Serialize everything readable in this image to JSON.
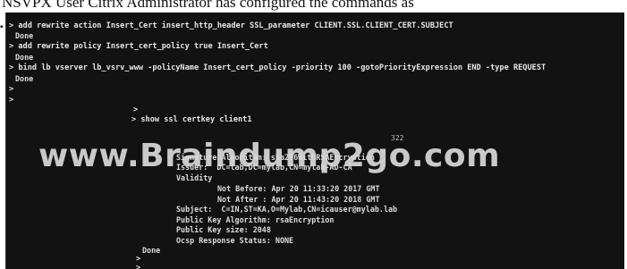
{
  "header_strip": {
    "text": "NSVPX User Citrix Administrator has configured the commands as"
  },
  "terminal": {
    "block1": [
      "> add rewrite action Insert_Cert insert_http_header SSL_parameter CLIENT.SSL.CLIENT_CERT.SUBJECT",
      "Done",
      "> add rewrite policy Insert_cert_policy true Insert_Cert",
      "Done",
      "> bind lb vserver lb_vsrv_www -policyName Insert_cert_policy -priority 100 -gotoPriorityExpression END -type REQUEST",
      "Done",
      ">",
      ">"
    ],
    "block2_prompt": ">",
    "block2_cmd": "> show ssl certkey client1",
    "obscured_fragment": "322",
    "block2_out": [
      "Signature Algorithm: sha256WithRSAEncryption",
      "Issuer:  DC=lab,DC=mylab,CN=mylab-AD-CA",
      "Validity",
      "Not Before: Apr 20 11:33:20 2017 GMT",
      "Not After : Apr 20 11:43:20 2018 GMT",
      "Subject:  C=IN,ST=KA,O=Mylab,CN=icauser@mylab.lab",
      "Public Key Algorithm: rsaEncryption",
      "Public Key size: 2048",
      "Ocsp Response Status: NONE"
    ],
    "block2_done": "Done",
    "block2_tail": [
      ">",
      ">"
    ]
  },
  "watermark": "www.Braindump2go.com"
}
